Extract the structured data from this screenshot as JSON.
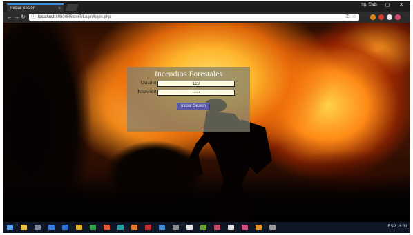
{
  "browser": {
    "tab_title": "Iniciar Sesion",
    "tab_close": "×",
    "user": "Ing. Elvis",
    "window_controls": "– ▢ ✕",
    "url_prefix": "localhost",
    "url_path": ":8080/IR/itemT/Login/login.php",
    "extensions": [
      {
        "name": "ext-orange-icon",
        "color": "#e08a1c"
      },
      {
        "name": "ext-red-icon",
        "color": "#d23a2a"
      },
      {
        "name": "ext-white-icon",
        "color": "#e8e8e8"
      },
      {
        "name": "ext-pink-icon",
        "color": "#d84a6a"
      }
    ]
  },
  "login": {
    "title": "Incendios Forestales",
    "user_label": "Usuario",
    "user_value": "123",
    "password_label": "Password",
    "password_value": "•••••",
    "submit_label": "Iniciar Sesion"
  },
  "taskbar": {
    "icons": [
      {
        "name": "start-icon",
        "color": "#5aa0e8"
      },
      {
        "name": "explorer-icon",
        "color": "#e8c24a"
      },
      {
        "name": "taskview-icon",
        "color": "#7a8aa0"
      },
      {
        "name": "edge-icon",
        "color": "#3a7ad8"
      },
      {
        "name": "app-blue-icon",
        "color": "#2f6fd0"
      },
      {
        "name": "app-yellow-icon",
        "color": "#e0b030"
      },
      {
        "name": "app-green-icon",
        "color": "#3aa04a"
      },
      {
        "name": "chrome-icon",
        "color": "#e05a3a"
      },
      {
        "name": "app-teal-icon",
        "color": "#2aa0a0"
      },
      {
        "name": "app-orange-icon",
        "color": "#e07a2a"
      },
      {
        "name": "app-red-icon",
        "color": "#c03030"
      },
      {
        "name": "app-sky-icon",
        "color": "#4a8ad0"
      },
      {
        "name": "app-gray-icon",
        "color": "#8a8a8a"
      },
      {
        "name": "file-icon",
        "color": "#e0e0e0"
      },
      {
        "name": "app-lime-icon",
        "color": "#6aa03a"
      },
      {
        "name": "app-ruby-icon",
        "color": "#c04a6a"
      },
      {
        "name": "notepad-icon",
        "color": "#e0e0e0"
      },
      {
        "name": "app-pink-icon",
        "color": "#d05080"
      },
      {
        "name": "app-amber-icon",
        "color": "#e0902a"
      },
      {
        "name": "settings-icon",
        "color": "#9a9a9a"
      }
    ],
    "tray": "ESP  16:31"
  }
}
